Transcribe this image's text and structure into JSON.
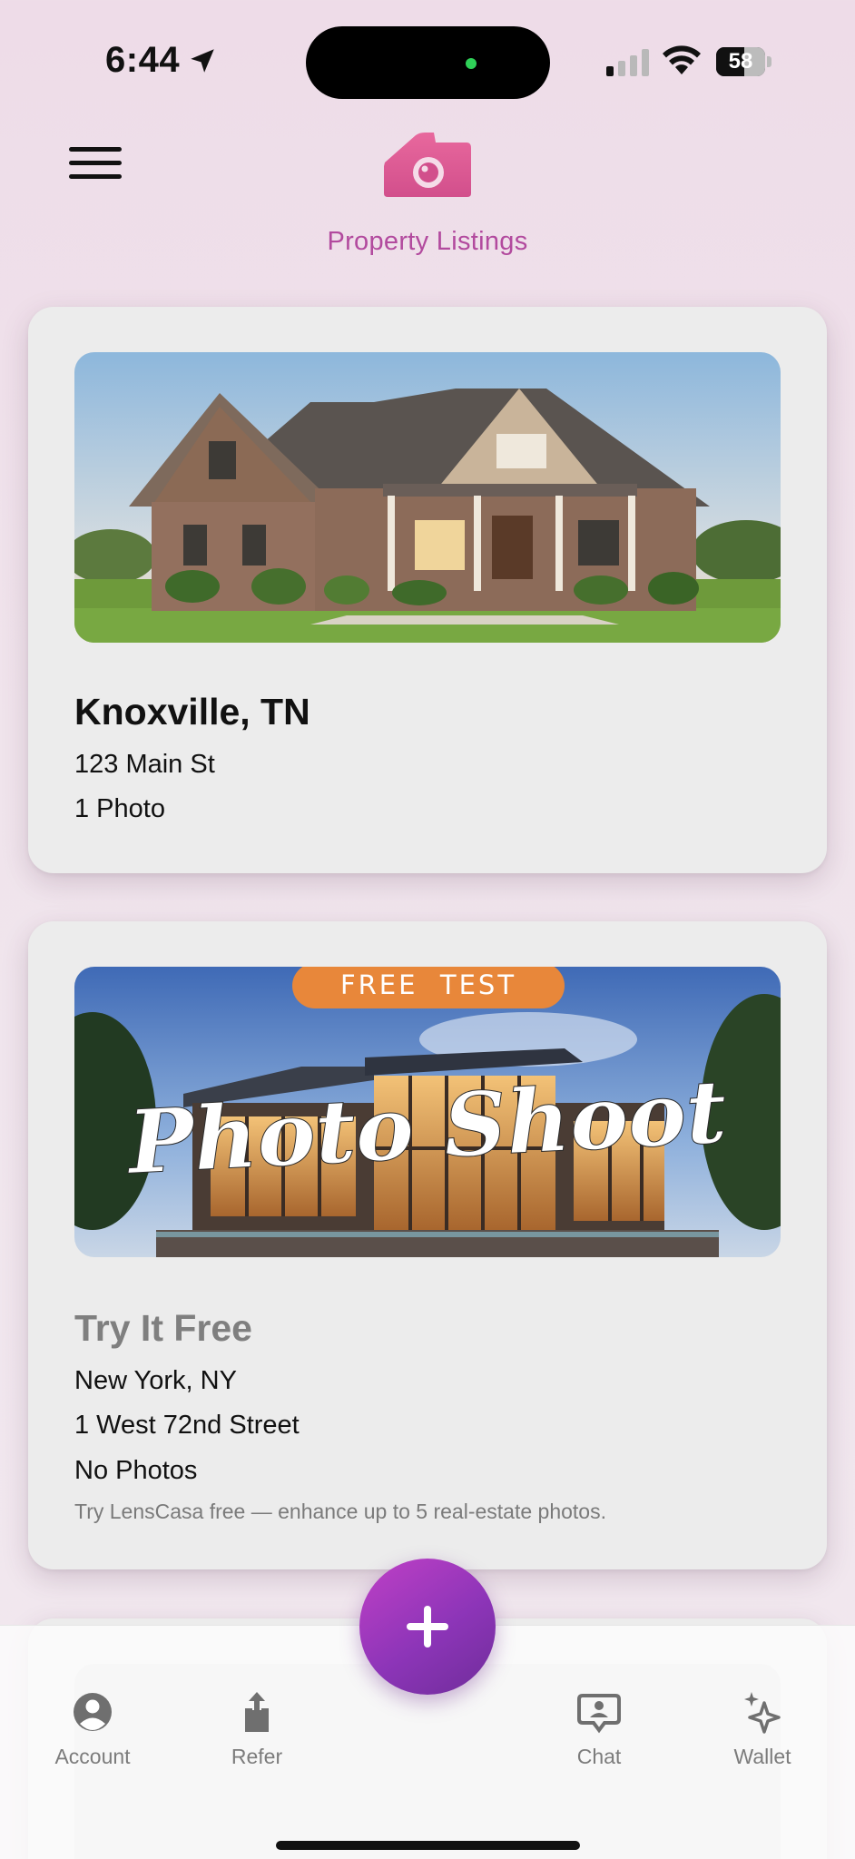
{
  "status_bar": {
    "time": "6:44",
    "battery_level": "58",
    "battery_percent": 58
  },
  "header": {
    "title": "Property Listings",
    "logo_icon": "camera-house-icon",
    "menu_icon": "hamburger-icon"
  },
  "listings": [
    {
      "title": "Knoxville, TN",
      "address": "123 Main St",
      "photo_count": "1 Photo",
      "image_icon": "house-photo"
    },
    {
      "title": "Try It Free",
      "city": "New York, NY",
      "address": "1 West 72nd Street",
      "photo_count": "No Photos",
      "note": "Try LensCasa free — enhance up to 5 real-estate photos.",
      "banner_badge": "FREE  TEST",
      "banner_text": "Photo Shoot"
    }
  ],
  "tabbar": {
    "account": "Account",
    "refer": "Refer",
    "chat": "Chat",
    "wallet": "Wallet",
    "add_icon": "plus-icon"
  },
  "colors": {
    "accent": "#b24a9e",
    "logo": "#d9578f",
    "fab": "#9b38bd",
    "badge": "#e8873a"
  }
}
